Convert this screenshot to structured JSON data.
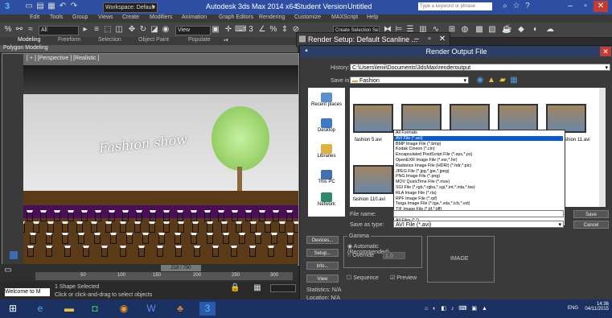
{
  "titlebar": {
    "workspace": "Workspace: Default",
    "app_title": "Autodesk 3ds Max  2014 x64",
    "edition": "Student Version",
    "doc_name": "Untitled",
    "search_placeholder": "Type a keyword or phrase"
  },
  "menu": [
    "Edit",
    "Tools",
    "Group",
    "Views",
    "Create",
    "Modifiers",
    "Animation",
    "Graph Editors",
    "Rendering",
    "Customize",
    "MAXScript",
    "Help"
  ],
  "toolbar": {
    "selection_filter": "All",
    "view_label": "View",
    "selection_set": "Create Selection Se"
  },
  "ribbon_tabs": [
    "Modeling",
    "Freeform",
    "Selection",
    "Object Paint",
    "Populate"
  ],
  "ribbon_panel": "Polygon Modeling",
  "viewport": {
    "label": "[ + ] [Perspective ] [Realistic ]",
    "scene_text": "Fashion show"
  },
  "timeline": {
    "frame": "218 / 750",
    "ticks": [
      "50",
      "100",
      "150",
      "200",
      "250",
      "300"
    ]
  },
  "status": {
    "welcome": "Welcome to M",
    "selection": "1 Shape Selected",
    "prompt": "Click or click-and-drag to select objects"
  },
  "render_setup": {
    "title": "Render Setup: Default Scanline ..."
  },
  "render_output": {
    "title": "Render Output File",
    "history_label": "History:",
    "history_value": "C:\\Users\\lenii\\Documents\\3dsMax\\renderoutput",
    "save_in_label": "Save in:",
    "save_in_value": "Fashion",
    "places": [
      "Recent places",
      "Desktop",
      "Libraries",
      "This PC",
      "Network"
    ],
    "files": [
      "fashion 5.avi",
      "fashion 110.avi",
      "fashion 11.avi"
    ],
    "file_name_label": "File name:",
    "save_as_label": "Save as type:",
    "save_as_value": "AVI File (*.avi)",
    "save_button": "Save",
    "cancel_button": "Cancel",
    "format_options": [
      "All Formats",
      "AVI File (*.avi)",
      "BMP Image File (*.bmp)",
      "Kodak Cineon (*.cin)",
      "Encapsulated PostScript File (*.eps,*.ps)",
      "OpenEXR Image File (*.exr,*.fxr)",
      "Radiance Image File (HDRI) (*.hdr,*.pic)",
      "JPEG File (*.jpg,*.jpe,*.jpeg)",
      "PNG Image File (*.png)",
      "MOV QuickTime File (*.mov)",
      "SGI File (*.rgb,*.rgba,*.sgi,*.int,*.inta,*.bw)",
      "RLA Image File (*.rla)",
      "RPF Image File (*.rpf)",
      "Targa Image File (*.tga,*.vda,*.icb,*.vst)",
      "TIF Image File (*.tif,*.tiff)",
      "DDS Image File (*.dds)",
      "All Files (*.*)"
    ],
    "devices_button": "Devices...",
    "setup_button": "Setup...",
    "info_button": "Info...",
    "view_button": "View",
    "gamma_label": "Gamma",
    "gamma_auto": "Automatic (Recommended)",
    "gamma_override": "Override",
    "gamma_value": "1.0",
    "sequence_label": "Sequence",
    "preview_label": "Preview",
    "image_label": "IMAGE",
    "statistics": "Statistics: N/A",
    "location": "Location: N/A"
  },
  "taskbar": {
    "lang": "ENG",
    "time": "14:36",
    "date": "04/11/2015"
  }
}
